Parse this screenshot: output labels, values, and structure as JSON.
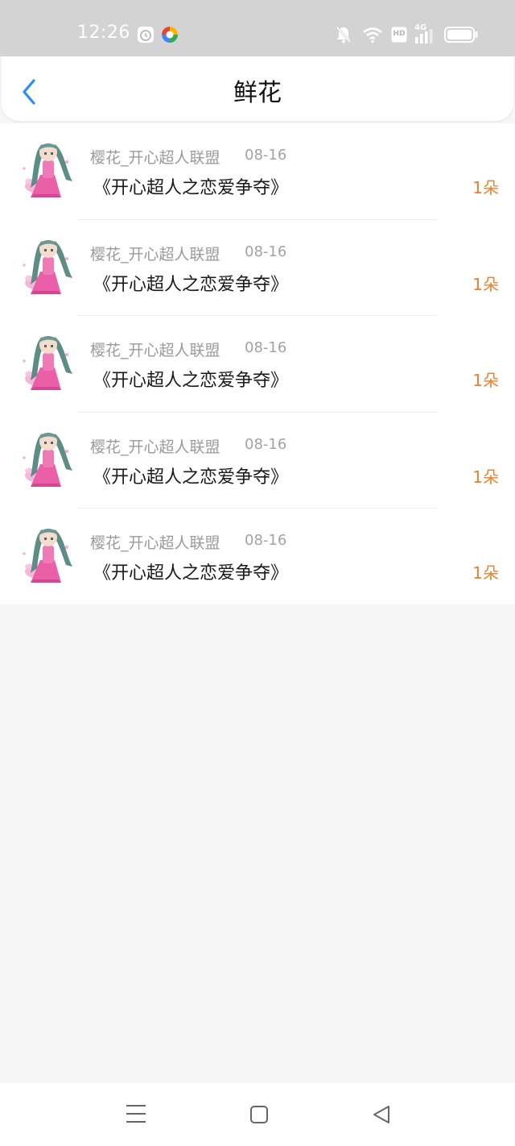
{
  "status_bar": {
    "time": "12:26",
    "network_label": "4G",
    "hd_label": "HD",
    "icons": [
      "alarm-clock-icon",
      "colorful-app-icon",
      "bell-muted-icon",
      "wifi-icon",
      "hd-icon",
      "signal-4g-icon",
      "battery-icon"
    ]
  },
  "header": {
    "title": "鲜花",
    "back_icon": "chevron-left-icon",
    "accent_color": "#2b8ff0"
  },
  "flowers": [
    {
      "sender": "樱花_开心超人联盟",
      "date": "08-16",
      "title": "《开心超人之恋爱争夺》",
      "count": "1朵"
    },
    {
      "sender": "樱花_开心超人联盟",
      "date": "08-16",
      "title": "《开心超人之恋爱争夺》",
      "count": "1朵"
    },
    {
      "sender": "樱花_开心超人联盟",
      "date": "08-16",
      "title": "《开心超人之恋爱争夺》",
      "count": "1朵"
    },
    {
      "sender": "樱花_开心超人联盟",
      "date": "08-16",
      "title": "《开心超人之恋爱争夺》",
      "count": "1朵"
    },
    {
      "sender": "樱花_开心超人联盟",
      "date": "08-16",
      "title": "《开心超人之恋爱争夺》",
      "count": "1朵"
    }
  ],
  "count_color": "#f07f2c",
  "nav_bar": {
    "icons": [
      "menu-icon",
      "home-square-icon",
      "back-triangle-icon"
    ]
  }
}
